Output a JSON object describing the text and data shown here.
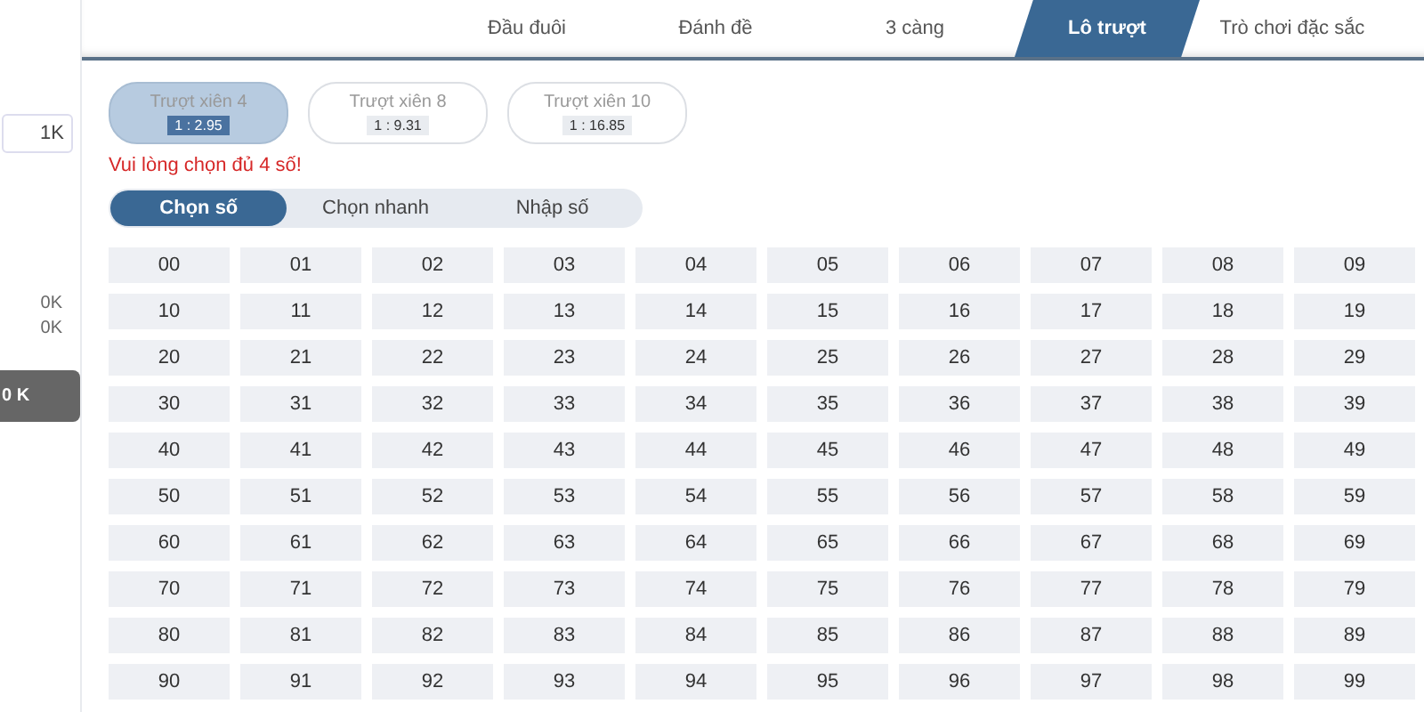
{
  "sidebar": {
    "amount": "1K",
    "totals": [
      "0K",
      "0K"
    ],
    "submit_button": "0 K"
  },
  "tabs": [
    {
      "label": "Đầu đuôi",
      "selected": false
    },
    {
      "label": "Đánh đề",
      "selected": false
    },
    {
      "label": "3 càng",
      "selected": false
    },
    {
      "label": "Lô trượt",
      "selected": true
    },
    {
      "label": "Trò chơi đặc sắc",
      "selected": false
    }
  ],
  "bet_types": [
    {
      "label": "Trượt xiên 4",
      "odds": "1 : 2.95",
      "selected": true
    },
    {
      "label": "Trượt xiên 8",
      "odds": "1 : 9.31",
      "selected": false
    },
    {
      "label": "Trượt xiên 10",
      "odds": "1 : 16.85",
      "selected": false
    }
  ],
  "warning": "Vui lòng chọn đủ 4 số!",
  "modes": [
    {
      "label": "Chọn số",
      "selected": true
    },
    {
      "label": "Chọn nhanh",
      "selected": false
    },
    {
      "label": "Nhập số",
      "selected": false
    }
  ],
  "numbers": [
    [
      "00",
      "01",
      "02",
      "03",
      "04",
      "05",
      "06",
      "07",
      "08",
      "09"
    ],
    [
      "10",
      "11",
      "12",
      "13",
      "14",
      "15",
      "16",
      "17",
      "18",
      "19"
    ],
    [
      "20",
      "21",
      "22",
      "23",
      "24",
      "25",
      "26",
      "27",
      "28",
      "29"
    ],
    [
      "30",
      "31",
      "32",
      "33",
      "34",
      "35",
      "36",
      "37",
      "38",
      "39"
    ],
    [
      "40",
      "41",
      "42",
      "43",
      "44",
      "45",
      "46",
      "47",
      "48",
      "49"
    ],
    [
      "50",
      "51",
      "52",
      "53",
      "54",
      "55",
      "56",
      "57",
      "58",
      "59"
    ],
    [
      "60",
      "61",
      "62",
      "63",
      "64",
      "65",
      "66",
      "67",
      "68",
      "69"
    ],
    [
      "70",
      "71",
      "72",
      "73",
      "74",
      "75",
      "76",
      "77",
      "78",
      "79"
    ],
    [
      "80",
      "81",
      "82",
      "83",
      "84",
      "85",
      "86",
      "87",
      "88",
      "89"
    ],
    [
      "90",
      "91",
      "92",
      "93",
      "94",
      "95",
      "96",
      "97",
      "98",
      "99"
    ]
  ]
}
